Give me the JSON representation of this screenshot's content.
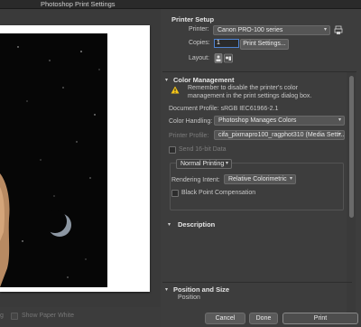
{
  "window": {
    "title": "Photoshop Print Settings"
  },
  "bottom_left": {
    "show_paper_white_label": "Show Paper White",
    "left_fragment": "g"
  },
  "printer_setup": {
    "heading": "Printer Setup",
    "printer_label": "Printer:",
    "printer_value": "Canon PRO-100 series",
    "copies_label": "Copies:",
    "copies_value": "1",
    "print_settings_button": "Print Settings...",
    "layout_label": "Layout:"
  },
  "color_management": {
    "heading": "Color Management",
    "warning_text_line1": "Remember to disable the printer's color",
    "warning_text_line2": "management in the print settings dialog box.",
    "document_profile": "Document Profile: sRGB IEC61966-2.1",
    "color_handling_label": "Color Handling:",
    "color_handling_value": "Photoshop Manages Colors",
    "printer_profile_label": "Printer Profile:",
    "printer_profile_value": "cifa_pixmapro100_ragphot310 (Media Setti...",
    "send_16bit_label": "Send 16-bit Data",
    "normal_printing_value": "Normal Printing",
    "rendering_intent_label": "Rendering Intent:",
    "rendering_intent_value": "Relative Colorimetric",
    "black_point_label": "Black Point Compensation"
  },
  "description": {
    "heading": "Description"
  },
  "position_size": {
    "heading": "Position and Size",
    "position_label": "Position"
  },
  "footer": {
    "cancel": "Cancel",
    "done": "Done",
    "print": "Print"
  },
  "colors": {
    "panel_bg": "#3d3d3d",
    "titlebar_bg": "#2a2a2a",
    "accent_blue": "#4f83d1",
    "warning_yellow": "#f5c518"
  },
  "icons": {
    "printer_icon": "printer-icon",
    "layout_portrait": "layout-portrait-icon",
    "layout_landscape": "layout-landscape-icon",
    "warning_icon": "warning-icon"
  }
}
